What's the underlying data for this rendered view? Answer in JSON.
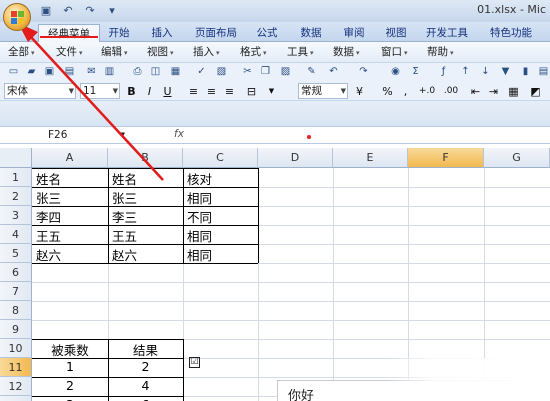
{
  "window": {
    "title": "01.xlsx - Mic"
  },
  "quick_access": {
    "undo": "↶",
    "redo": "↷",
    "customize": "▾"
  },
  "ribbon_tabs": [
    {
      "label": "经典菜单",
      "active": true
    },
    {
      "label": "开始"
    },
    {
      "label": "插入"
    },
    {
      "label": "页面布局"
    },
    {
      "label": "公式"
    },
    {
      "label": "数据"
    },
    {
      "label": "审阅"
    },
    {
      "label": "视图"
    },
    {
      "label": "开发工具"
    },
    {
      "label": "特色功能"
    }
  ],
  "menus": [
    "全部",
    "文件",
    "编辑",
    "视图",
    "插入",
    "格式",
    "工具",
    "数据",
    "窗口",
    "帮助"
  ],
  "format_bar": {
    "font_name": "宋体",
    "font_size": "11",
    "bold": "B",
    "italic": "I",
    "underline": "U",
    "number_format": "常规",
    "percent": "%",
    "comma": ",",
    "decimals_inc": "+.0",
    "decimals_dec": ".00"
  },
  "formula_bar": {
    "name_box": "F26",
    "fx": "fx",
    "value": ""
  },
  "columns": [
    "A",
    "B",
    "C",
    "D",
    "E",
    "F",
    "G"
  ],
  "selected_column": "F",
  "rows": [
    "1",
    "2",
    "3",
    "4",
    "5",
    "6",
    "7",
    "8",
    "9",
    "10",
    "11",
    "12",
    "13"
  ],
  "selected_row": "11",
  "table1": {
    "headers": [
      "姓名",
      "姓名",
      "核对"
    ],
    "rows": [
      [
        "张三",
        "张三",
        "相同"
      ],
      [
        "李四",
        "李三",
        "不同"
      ],
      [
        "王五",
        "王五",
        "相同"
      ],
      [
        "赵六",
        "赵六",
        "相同"
      ]
    ]
  },
  "table2": {
    "headers": [
      "被乘数",
      "结果"
    ],
    "rows": [
      [
        "1",
        "2"
      ],
      [
        "2",
        "4"
      ],
      [
        "3",
        "6"
      ]
    ]
  },
  "checkbox": {
    "checked": true,
    "glyph": "☑"
  },
  "textbox": {
    "text": "你好"
  },
  "colors": {
    "annotation_red": "#e31b1b",
    "selection_orange": "#f2b94f"
  }
}
